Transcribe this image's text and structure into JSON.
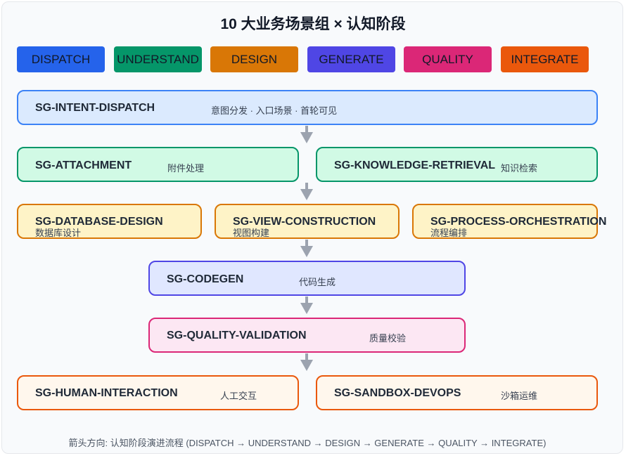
{
  "title": "10 大业务场景组 × 认知阶段",
  "stages": [
    {
      "label": "DISPATCH",
      "color": "#2563eb"
    },
    {
      "label": "UNDERSTAND",
      "color": "#059669"
    },
    {
      "label": "DESIGN",
      "color": "#d97706"
    },
    {
      "label": "GENERATE",
      "color": "#4f46e5"
    },
    {
      "label": "QUALITY",
      "color": "#db2777"
    },
    {
      "label": "INTEGRATE",
      "color": "#ea580c"
    }
  ],
  "groups": {
    "intent_dispatch": {
      "code": "SG-INTENT-DISPATCH",
      "desc": "意图分发 · 入口场景 · 首轮可见"
    },
    "attachment": {
      "code": "SG-ATTACHMENT",
      "desc": "附件处理"
    },
    "knowledge_retrieval": {
      "code": "SG-KNOWLEDGE-RETRIEVAL",
      "desc": "知识检索"
    },
    "database_design": {
      "code": "SG-DATABASE-DESIGN",
      "desc": "数据库设计"
    },
    "view_construction": {
      "code": "SG-VIEW-CONSTRUCTION",
      "desc": "视图构建"
    },
    "process_orchestration": {
      "code": "SG-PROCESS-ORCHESTRATION",
      "desc": "流程编排"
    },
    "codegen": {
      "code": "SG-CODEGEN",
      "desc": "代码生成"
    },
    "quality_validation": {
      "code": "SG-QUALITY-VALIDATION",
      "desc": "质量校验"
    },
    "human_interaction": {
      "code": "SG-HUMAN-INTERACTION",
      "desc": "人工交互"
    },
    "sandbox_devops": {
      "code": "SG-SANDBOX-DEVOPS",
      "desc": "沙箱运维"
    }
  },
  "footer": "箭头方向: 认知阶段演进流程 (DISPATCH → UNDERSTAND → DESIGN → GENERATE → QUALITY → INTEGRATE)"
}
